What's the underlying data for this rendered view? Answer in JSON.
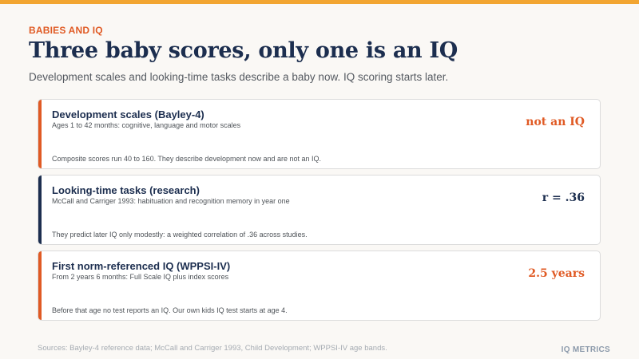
{
  "header": {
    "kicker": "BABIES AND IQ",
    "title": "Three baby scores, only one is an IQ",
    "subtitle": "Development scales and looking-time tasks describe a baby now. IQ scoring starts later."
  },
  "cards": [
    {
      "title": "Development scales (Bayley-4)",
      "meta": "Ages 1 to 42 months: cognitive, language and motor scales",
      "note": "Composite scores run 40 to 160. They describe development now and are not an IQ.",
      "stat": "not an IQ",
      "accent_color": "#e05a24",
      "stat_color": "#e05a24"
    },
    {
      "title": "Looking-time tasks (research)",
      "meta": "McCall and Carriger 1993: habituation and recognition memory in year one",
      "note": "They predict later IQ only modestly: a weighted correlation of .36 across studies.",
      "stat": "r = .36",
      "accent_color": "#1c2e4f",
      "stat_color": "#1c2e4f"
    },
    {
      "title": "First norm-referenced IQ (WPPSI-IV)",
      "meta": "From 2 years 6 months: Full Scale IQ plus index scores",
      "note": "Before that age no test reports an IQ. Our own kids IQ test starts at age 4.",
      "stat": "2.5 years",
      "accent_color": "#e05a24",
      "stat_color": "#e05a24"
    }
  ],
  "footer": {
    "sources": "Sources: Bayley-4 reference data; McCall and Carriger 1993, Child Development; WPPSI-IV age bands.",
    "brand": "IQ METRICS"
  },
  "colors": {
    "accent_bar": "#f2a531",
    "orange": "#e05a24",
    "navy": "#1c2e4f"
  }
}
